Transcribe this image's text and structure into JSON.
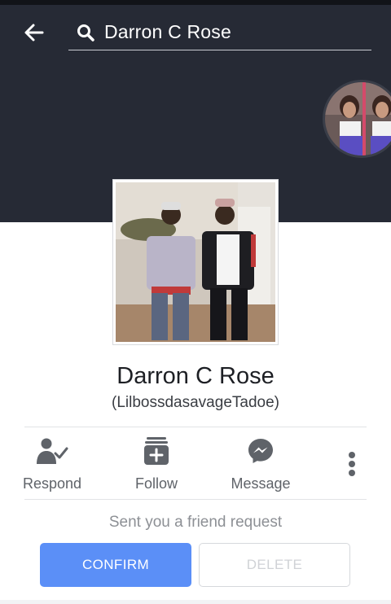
{
  "header": {
    "search_query": "Darron C Rose"
  },
  "profile": {
    "name": "Darron C Rose",
    "alias": "(LilbossdasavageTadoe)"
  },
  "actions": [
    {
      "id": "respond",
      "label": "Respond",
      "icon": "person-check-icon"
    },
    {
      "id": "follow",
      "label": "Follow",
      "icon": "follow-plus-icon"
    },
    {
      "id": "message",
      "label": "Message",
      "icon": "messenger-icon"
    }
  ],
  "friend_request": {
    "text": "Sent you a friend request",
    "confirm_label": "CONFIRM",
    "delete_label": "DELETE"
  },
  "colors": {
    "cover": "#262a35",
    "confirm": "#5b8ff7",
    "icon": "#5f6369"
  }
}
